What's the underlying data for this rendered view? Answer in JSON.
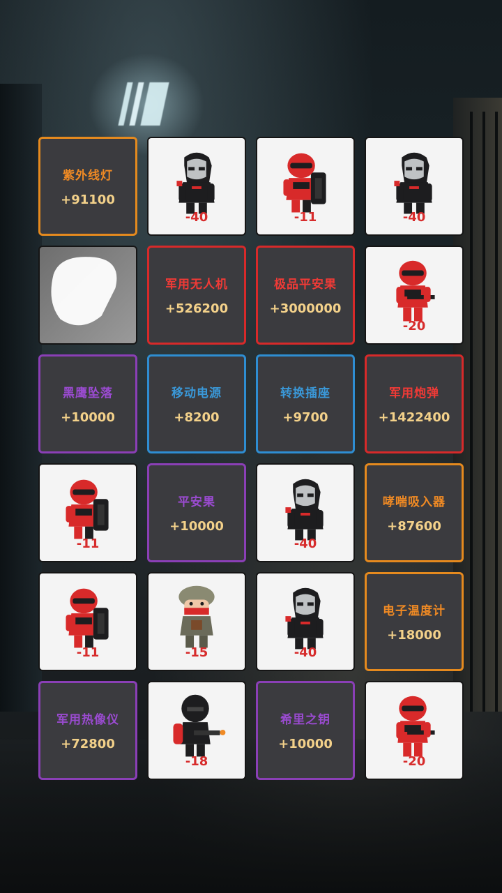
{
  "grid": {
    "rows": [
      [
        {
          "kind": "item",
          "rarity": "orange",
          "name": "紫外线灯",
          "value": "+91100"
        },
        {
          "kind": "enemy",
          "enemy": "masked-assassin",
          "value": "-40"
        },
        {
          "kind": "enemy",
          "enemy": "red-shield-soldier",
          "value": "-11"
        },
        {
          "kind": "enemy",
          "enemy": "masked-assassin",
          "value": "-40"
        }
      ],
      [
        {
          "kind": "hidden",
          "icon": "blob-icon"
        },
        {
          "kind": "item",
          "rarity": "red",
          "name": "军用无人机",
          "value": "+526200"
        },
        {
          "kind": "item",
          "rarity": "red",
          "name": "极品平安果",
          "value": "+3000000"
        },
        {
          "kind": "enemy",
          "enemy": "red-rifle-soldier",
          "value": "-20"
        }
      ],
      [
        {
          "kind": "item",
          "rarity": "purple",
          "name": "黑鹰坠落",
          "value": "+10000"
        },
        {
          "kind": "item",
          "rarity": "blue",
          "name": "移动电源",
          "value": "+8200"
        },
        {
          "kind": "item",
          "rarity": "blue",
          "name": "转换插座",
          "value": "+9700"
        },
        {
          "kind": "item",
          "rarity": "red",
          "name": "军用炮弹",
          "value": "+1422400"
        }
      ],
      [
        {
          "kind": "enemy",
          "enemy": "red-shield-soldier",
          "value": "-11"
        },
        {
          "kind": "item",
          "rarity": "purple",
          "name": "平安果",
          "value": "+10000"
        },
        {
          "kind": "enemy",
          "enemy": "masked-assassin",
          "value": "-40"
        },
        {
          "kind": "item",
          "rarity": "orange",
          "name": "哮喘吸入器",
          "value": "+87600"
        }
      ],
      [
        {
          "kind": "enemy",
          "enemy": "red-shield-soldier",
          "value": "-11"
        },
        {
          "kind": "enemy",
          "enemy": "helmet-soldier",
          "value": "-15"
        },
        {
          "kind": "enemy",
          "enemy": "masked-assassin",
          "value": "-40"
        },
        {
          "kind": "item",
          "rarity": "orange",
          "name": "电子温度计",
          "value": "+18000"
        }
      ],
      [
        {
          "kind": "item",
          "rarity": "purple",
          "name": "军用热像仪",
          "value": "+72800"
        },
        {
          "kind": "enemy",
          "enemy": "black-flamethrower",
          "value": "-18"
        },
        {
          "kind": "item",
          "rarity": "purple",
          "name": "希里之钥",
          "value": "+10000"
        },
        {
          "kind": "enemy",
          "enemy": "red-rifle-soldier",
          "value": "-20"
        }
      ]
    ]
  },
  "colors": {
    "orange": "#e58a1e",
    "red": "#d62a2a",
    "purple": "#8a3fb6",
    "blue": "#2e8ed2",
    "value_text": "#f3d18a",
    "penalty_text": "#d72c2c"
  }
}
